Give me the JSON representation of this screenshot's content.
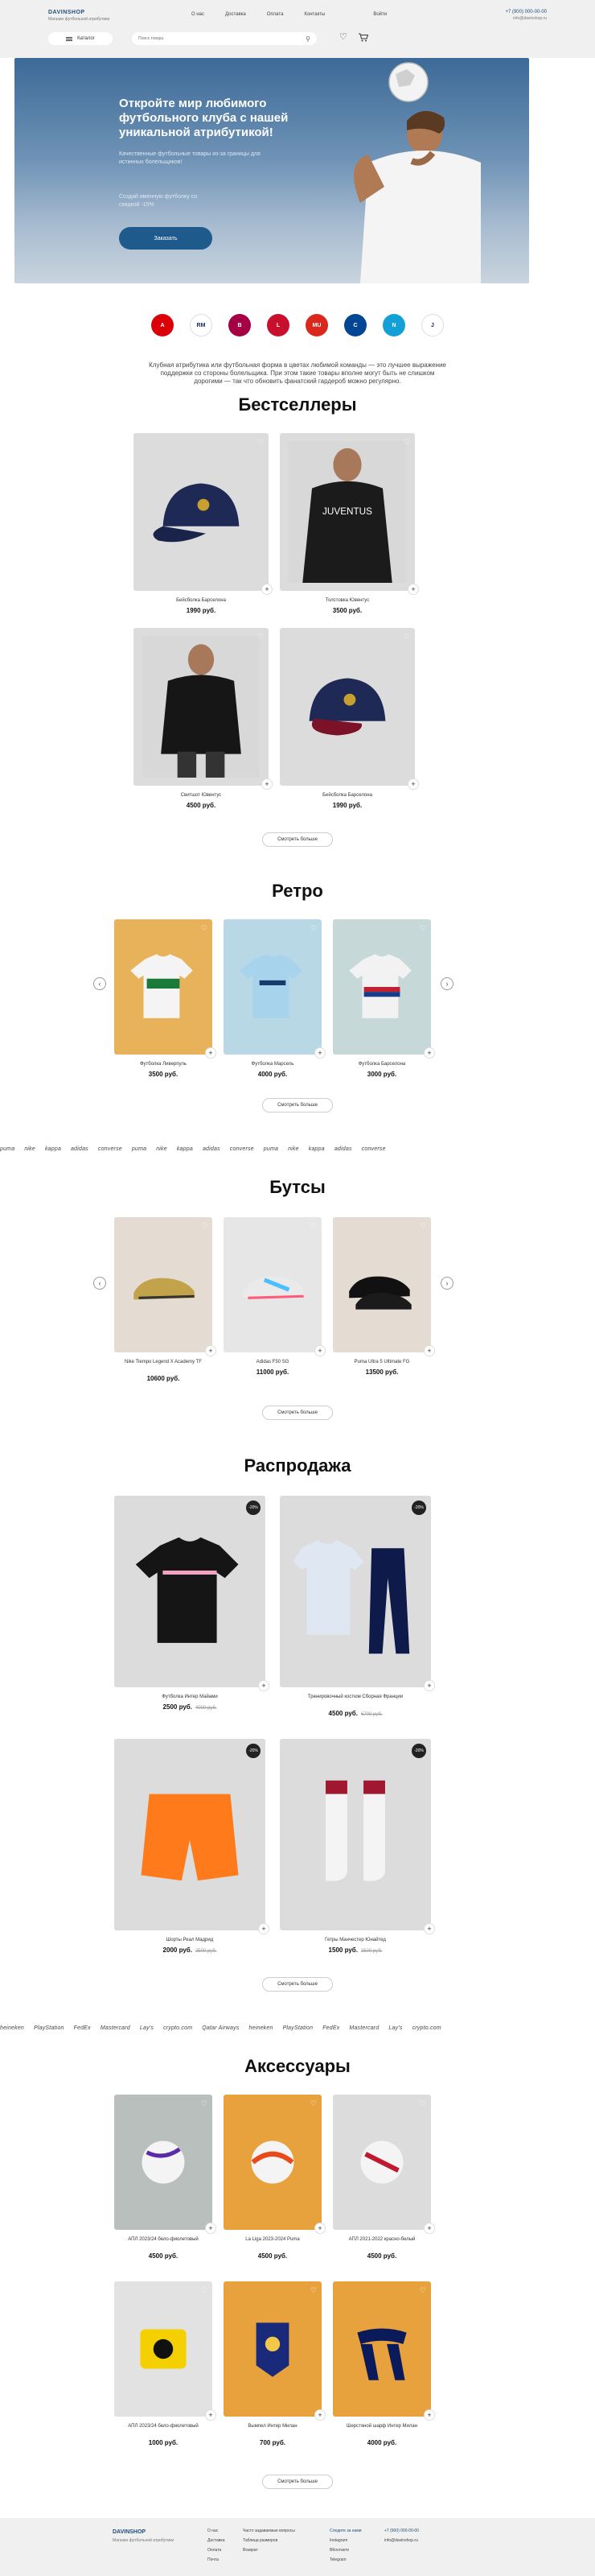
{
  "header": {
    "logo_title": "DAVINSHOP",
    "logo_sub": "Магазин футбольной атрибутики",
    "nav": [
      "О нас",
      "Доставка",
      "Оплата",
      "Контакты"
    ],
    "login": "Войти",
    "phone": "+7 (900) 000-00-00",
    "email": "info@davinshop.ru",
    "catalog": "Каталог",
    "search_placeholder": "Поиск товара"
  },
  "hero": {
    "title": "Откройте мир любимого футбольного клуба с нашей уникальной атрибутикой!",
    "subtitle": "Качественные футбольные товары из-за границы для истинных болельщиков!",
    "hint": "Создай именную футболку со скидкой -15%",
    "button": "Заказать"
  },
  "clubs": [
    {
      "name": "arsenal-logo",
      "color": "#db0007",
      "text": "A"
    },
    {
      "name": "real-madrid-logo",
      "color": "#ffffff",
      "text": "RM"
    },
    {
      "name": "barcelona-logo",
      "color": "#a50044",
      "text": "B"
    },
    {
      "name": "liverpool-logo",
      "color": "#c8102e",
      "text": "L"
    },
    {
      "name": "man-united-logo",
      "color": "#da291c",
      "text": "MU"
    },
    {
      "name": "chelsea-logo",
      "color": "#034694",
      "text": "C"
    },
    {
      "name": "napoli-logo",
      "color": "#12a0d7",
      "text": "N"
    },
    {
      "name": "juventus-logo",
      "color": "#ffffff",
      "text": "J"
    }
  ],
  "intro": "Клубная атрибутика или футбольная форма в цветах любимой команды — это лучшее выражение поддержки со стороны болельщика. При этом такие товары вполне могут быть не слишком дорогими — так что обновить фанатский гардероб можно регулярно.",
  "bestsellers": {
    "title": "Бестселлеры",
    "more": "Смотреть больше",
    "items": [
      {
        "name": "Бейсболка Барселона",
        "price": "1990 руб."
      },
      {
        "name": "Толстовка Ювентус",
        "price": "3500 руб."
      },
      {
        "name": "Свитшот Ювентус",
        "price": "4500 руб."
      },
      {
        "name": "Бейсболка Барселона",
        "price": "1990 руб."
      }
    ]
  },
  "retro": {
    "title": "Ретро",
    "more": "Смотреть больше",
    "items": [
      {
        "name": "Футболка Ливерпуль",
        "price": "3500 руб."
      },
      {
        "name": "Футболка Марсель",
        "price": "4000 руб."
      },
      {
        "name": "Футболка Барселона",
        "price": "3000 руб."
      }
    ]
  },
  "brands1": [
    "puma",
    "nike",
    "kappa",
    "adidas",
    "converse",
    "puma",
    "nike",
    "kappa",
    "adidas",
    "converse",
    "puma",
    "nike",
    "kappa",
    "adidas",
    "converse"
  ],
  "boots": {
    "title": "Бутсы",
    "more": "Смотреть больше",
    "items": [
      {
        "name": "Nike Tiempo Legend X Academy TF",
        "price": "10600 руб."
      },
      {
        "name": "Adidas F50 SG",
        "price": "11000 руб."
      },
      {
        "name": "Puma Ultra 5 Ultimate FG",
        "price": "13500 руб."
      }
    ]
  },
  "sale": {
    "title": "Распродажа",
    "more": "Смотреть больше",
    "items": [
      {
        "name": "Футболка Интер Майами",
        "price": "2500 руб.",
        "old": "4000 руб.",
        "badge": "-20%"
      },
      {
        "name": "Тренировочный костюм Сборная Франции",
        "price": "4500 руб.",
        "old": "6700 руб.",
        "badge": "-20%"
      },
      {
        "name": "Шорты Реал Мадрид",
        "price": "2000 руб.",
        "old": "2500 руб.",
        "badge": "-20%"
      },
      {
        "name": "Гетры Манчестер Юнайтед",
        "price": "1500 руб.",
        "old": "2500 руб.",
        "badge": "-20%"
      }
    ]
  },
  "brands2": [
    "heineken",
    "PlayStation",
    "FedEx",
    "Mastercard",
    "Lay's",
    "crypto.com",
    "Qatar Airways",
    "heineken",
    "PlayStation",
    "FedEx",
    "Mastercard",
    "Lay's",
    "crypto.com"
  ],
  "accessories": {
    "title": "Аксессуары",
    "more": "Смотреть больше",
    "items": [
      {
        "name": "АПЛ 2023/24 белo-фиолетовый",
        "price": "4500 руб."
      },
      {
        "name": "La Liga 2023-2024 Puma",
        "price": "4500 руб."
      },
      {
        "name": "АПЛ 2021-2022 красно-белый",
        "price": "4500 руб."
      },
      {
        "name": "АПЛ 2023/24 белo-фиолетовый",
        "price": "1000 руб."
      },
      {
        "name": "Вымпел Интер Милан",
        "price": "700 руб."
      },
      {
        "name": "Шерстяной шарф Интер Милан",
        "price": "4000 руб."
      }
    ]
  },
  "footer": {
    "logo_title": "DAVINSHOP",
    "logo_sub": "Магазин футбольной атрибутики",
    "col1": [
      "О нас",
      "Доставка",
      "Оплата",
      "Почта"
    ],
    "col2": [
      "Часто задаваемые вопросы",
      "Таблица размеров",
      "Возврат"
    ],
    "col3": [
      "Следите за нами",
      "Instagram",
      "ВКонтакте",
      "Telegram"
    ],
    "phone": "+7 (900) 000-00-00",
    "email": "info@davinshop.ru"
  }
}
